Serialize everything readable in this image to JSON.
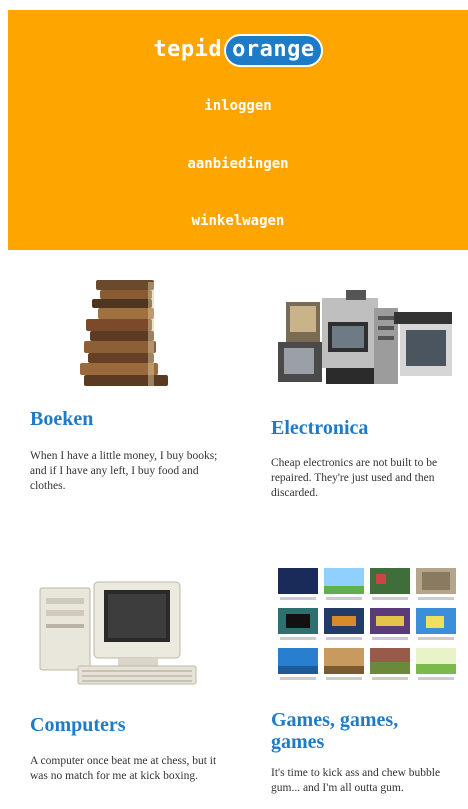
{
  "header": {
    "logo_part1": "tepid",
    "logo_part2": "orange",
    "nav": [
      "inloggen",
      "aanbiedingen",
      "winkelwagen"
    ]
  },
  "colors": {
    "header_bg": "#ffa500",
    "accent": "#1e7bc8",
    "text": "#333333"
  },
  "products": [
    {
      "title": "Boeken",
      "text": "When I have a little money, I buy books; and if I have any left, I buy food and clothes.",
      "image": "books-stack-image"
    },
    {
      "title": "Electronica",
      "text": "Cheap electronics are not built to be repaired. They're just used and then discarded.",
      "image": "electronics-pile-image"
    },
    {
      "title": "Computers",
      "text": "A computer once beat me at chess, but it was no match for me at kick boxing.",
      "image": "retro-computer-image"
    },
    {
      "title": "Games, games, games",
      "text": "It's time to kick ass and chew bubble gum... and I'm all outta gum.",
      "image": "game-screenshots-image"
    }
  ]
}
